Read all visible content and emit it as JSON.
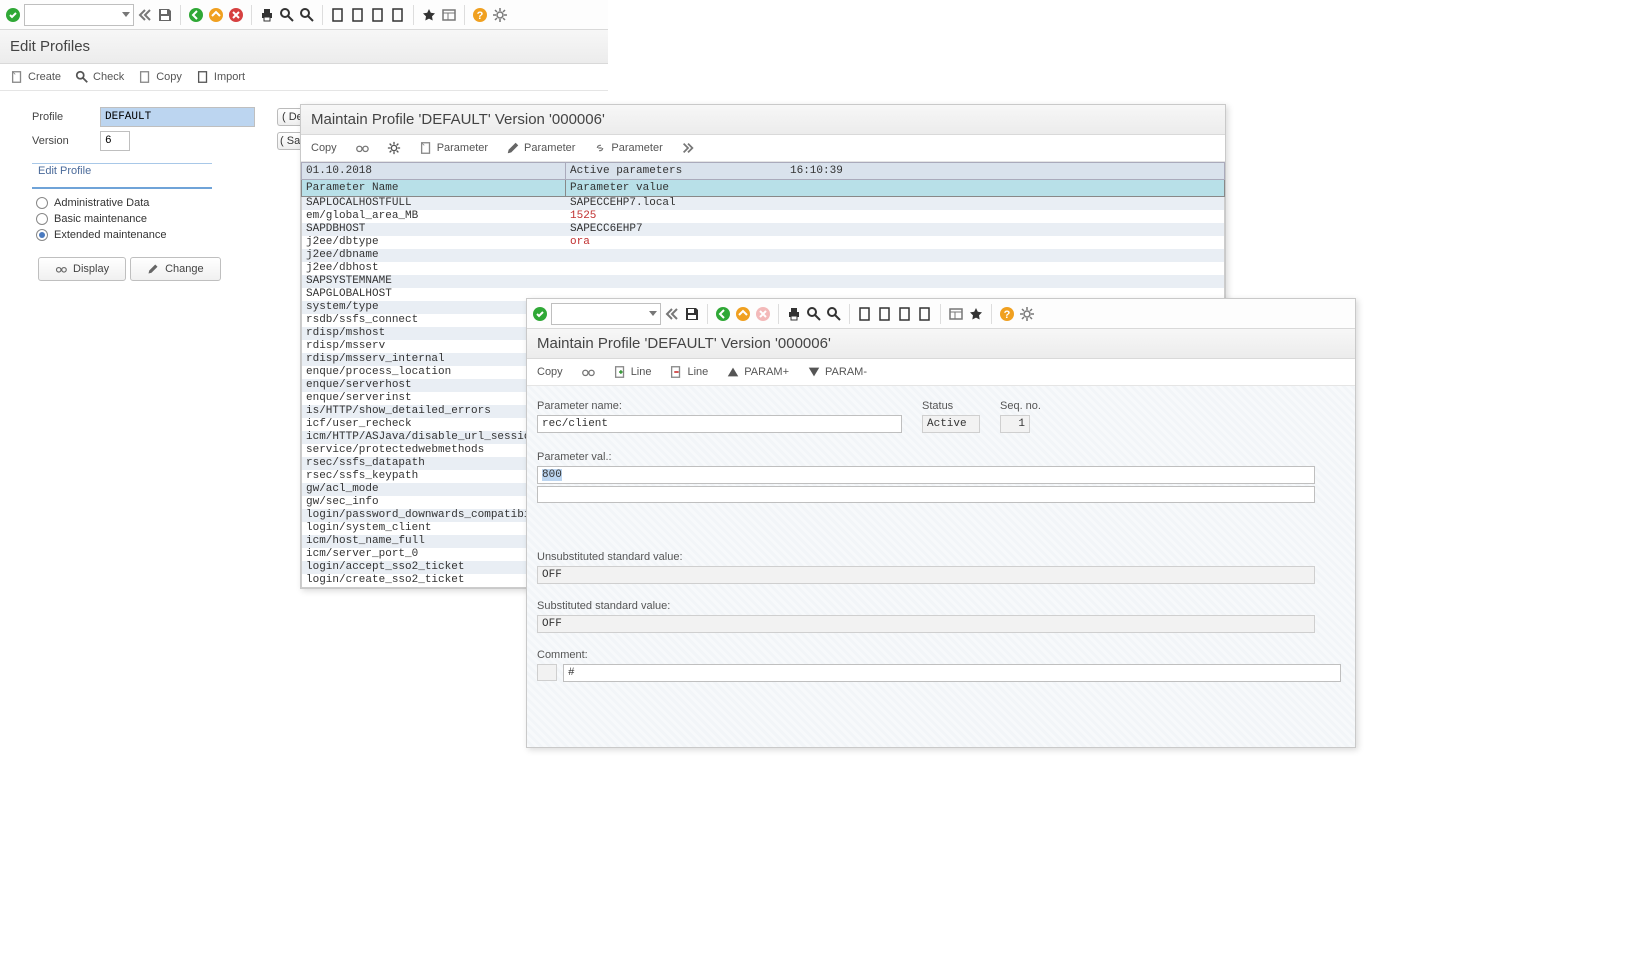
{
  "main": {
    "title": "Edit Profiles",
    "actions": {
      "create": "Create",
      "check": "Check",
      "copy": "Copy",
      "import": "Import"
    },
    "form": {
      "profile_label": "Profile",
      "profile_value": "DEFAULT",
      "version_label": "Version",
      "version_value": "6",
      "btn_de": "De",
      "btn_save": "Sav"
    },
    "group": {
      "legend": "Edit Profile",
      "r1": "Administrative Data",
      "r2": "Basic maintenance",
      "r3": "Extended maintenance",
      "display": "Display",
      "change": "Change"
    }
  },
  "mid": {
    "title": "Maintain Profile 'DEFAULT' Version '000006'",
    "actions": {
      "copy": "Copy",
      "param": "Parameter"
    },
    "header": {
      "date": "01.10.2018",
      "caption": "Active parameters",
      "time": "16:10:39"
    },
    "cols": {
      "name": "Parameter Name",
      "value": "Parameter value"
    },
    "rows": [
      {
        "n": "",
        "v": ""
      },
      {
        "n": "SAPLOCALHOSTFULL",
        "v": "SAPECCEHP7.local"
      },
      {
        "n": "em/global_area_MB",
        "v": "1525",
        "red": true
      },
      {
        "n": "SAPDBHOST",
        "v": "SAPECC6EHP7"
      },
      {
        "n": "j2ee/dbtype",
        "v": "ora",
        "red": true
      },
      {
        "n": "j2ee/dbname",
        "v": ""
      },
      {
        "n": "j2ee/dbhost",
        "v": ""
      },
      {
        "n": "SAPSYSTEMNAME",
        "v": ""
      },
      {
        "n": "SAPGLOBALHOST",
        "v": ""
      },
      {
        "n": "system/type",
        "v": ""
      },
      {
        "n": "rsdb/ssfs_connect",
        "v": ""
      },
      {
        "n": "rdisp/mshost",
        "v": ""
      },
      {
        "n": "rdisp/msserv",
        "v": ""
      },
      {
        "n": "rdisp/msserv_internal",
        "v": ""
      },
      {
        "n": "enque/process_location",
        "v": ""
      },
      {
        "n": "enque/serverhost",
        "v": ""
      },
      {
        "n": "enque/serverinst",
        "v": ""
      },
      {
        "n": "is/HTTP/show_detailed_errors",
        "v": ""
      },
      {
        "n": "icf/user_recheck",
        "v": ""
      },
      {
        "n": "icm/HTTP/ASJava/disable_url_session_t",
        "v": ""
      },
      {
        "n": "service/protectedwebmethods",
        "v": ""
      },
      {
        "n": "rsec/ssfs_datapath",
        "v": ""
      },
      {
        "n": "rsec/ssfs_keypath",
        "v": ""
      },
      {
        "n": "gw/acl_mode",
        "v": ""
      },
      {
        "n": "gw/sec_info",
        "v": ""
      },
      {
        "n": "login/password_downwards_compatibilit",
        "v": ""
      },
      {
        "n": "login/system_client",
        "v": ""
      },
      {
        "n": "icm/host_name_full",
        "v": ""
      },
      {
        "n": "icm/server_port_0",
        "v": ""
      },
      {
        "n": "login/accept_sso2_ticket",
        "v": ""
      },
      {
        "n": "login/create_sso2_ticket",
        "v": ""
      }
    ]
  },
  "front": {
    "title": "Maintain Profile 'DEFAULT' Version '000006'",
    "actions": {
      "copy": "Copy",
      "line": "Line",
      "paramp": "PARAM+",
      "paramm": "PARAM-"
    },
    "form": {
      "pname_label": "Parameter name:",
      "pname_value": "rec/client",
      "status_label": "Status",
      "status_value": "Active",
      "seq_label": "Seq. no.",
      "seq_value": "1",
      "pval_label": "Parameter val.:",
      "pval_value": "800",
      "pval_value2": "",
      "unsub_label": "Unsubstituted standard value:",
      "unsub_value": "OFF",
      "sub_label": "Substituted standard value:",
      "sub_value": "OFF",
      "comment_label": "Comment:",
      "comment_value": "#"
    }
  }
}
